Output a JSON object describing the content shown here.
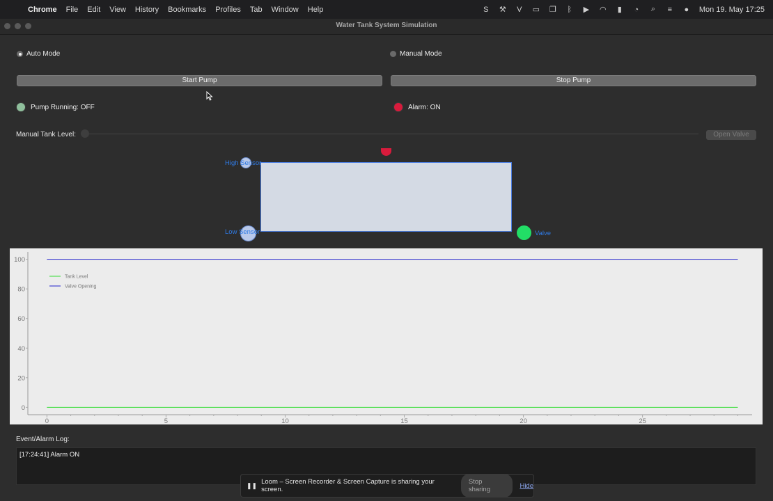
{
  "menubar": {
    "apple_icon": "apple-logo-icon",
    "app_name": "Chrome",
    "items": [
      "File",
      "Edit",
      "View",
      "History",
      "Bookmarks",
      "Profiles",
      "Tab",
      "Window",
      "Help"
    ],
    "clock": "Mon 19. May  17:25"
  },
  "window": {
    "title": "Water Tank System Simulation"
  },
  "modes": {
    "auto_label": "Auto Mode",
    "manual_label": "Manual Mode",
    "selected": "Auto Mode"
  },
  "buttons": {
    "start_pump": "Start Pump",
    "stop_pump": "Stop Pump",
    "open_valve": "Open Valve"
  },
  "indicators": {
    "pump_label": "Pump Running: OFF",
    "pump_color": "#8fbf9c",
    "alarm_label": "Alarm: ON",
    "alarm_color": "#d81b3c"
  },
  "manual_slider": {
    "label": "Manual Tank Level:"
  },
  "scene": {
    "high_sensor_label": "High Sensor",
    "low_sensor_label": "Low Sensor",
    "valve_label": "Valve",
    "valve_color": "#22dd66",
    "top_indicator_color": "#d81b3c",
    "tank_fill_fraction": 0.0
  },
  "chart_data": {
    "type": "line",
    "x": [
      0,
      29
    ],
    "xticks": [
      0,
      5,
      10,
      15,
      20,
      25
    ],
    "yticks": [
      0,
      20,
      40,
      60,
      80,
      100
    ],
    "xlim": [
      -0.8,
      29.6
    ],
    "ylim": [
      -5,
      105
    ],
    "series": [
      {
        "name": "Tank Level",
        "color": "#33dd33",
        "values": [
          0,
          0
        ]
      },
      {
        "name": "Valve Opening",
        "color": "#2222cc",
        "values": [
          100,
          100
        ]
      }
    ],
    "legend_position": "top-left",
    "grid": false
  },
  "log": {
    "label": "Event/Alarm Log:",
    "entries": [
      "[17:24:41] Alarm ON"
    ]
  },
  "loom_banner": {
    "message": "Loom – Screen Recorder & Screen Capture is sharing your screen.",
    "stop_label": "Stop sharing",
    "hide_label": "Hide"
  }
}
